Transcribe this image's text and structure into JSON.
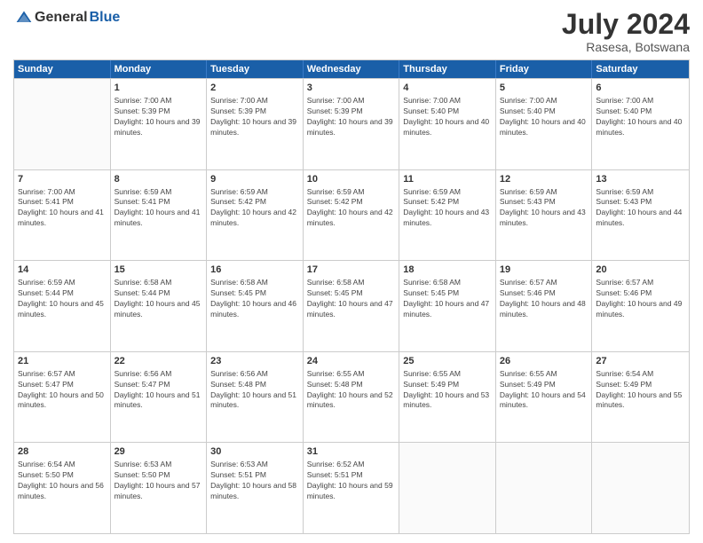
{
  "logo": {
    "general": "General",
    "blue": "Blue"
  },
  "header": {
    "month_year": "July 2024",
    "location": "Rasesa, Botswana"
  },
  "weekdays": [
    "Sunday",
    "Monday",
    "Tuesday",
    "Wednesday",
    "Thursday",
    "Friday",
    "Saturday"
  ],
  "weeks": [
    [
      {
        "day": "",
        "sunrise": "",
        "sunset": "",
        "daylight": ""
      },
      {
        "day": "1",
        "sunrise": "Sunrise: 7:00 AM",
        "sunset": "Sunset: 5:39 PM",
        "daylight": "Daylight: 10 hours and 39 minutes."
      },
      {
        "day": "2",
        "sunrise": "Sunrise: 7:00 AM",
        "sunset": "Sunset: 5:39 PM",
        "daylight": "Daylight: 10 hours and 39 minutes."
      },
      {
        "day": "3",
        "sunrise": "Sunrise: 7:00 AM",
        "sunset": "Sunset: 5:39 PM",
        "daylight": "Daylight: 10 hours and 39 minutes."
      },
      {
        "day": "4",
        "sunrise": "Sunrise: 7:00 AM",
        "sunset": "Sunset: 5:40 PM",
        "daylight": "Daylight: 10 hours and 40 minutes."
      },
      {
        "day": "5",
        "sunrise": "Sunrise: 7:00 AM",
        "sunset": "Sunset: 5:40 PM",
        "daylight": "Daylight: 10 hours and 40 minutes."
      },
      {
        "day": "6",
        "sunrise": "Sunrise: 7:00 AM",
        "sunset": "Sunset: 5:40 PM",
        "daylight": "Daylight: 10 hours and 40 minutes."
      }
    ],
    [
      {
        "day": "7",
        "sunrise": "Sunrise: 7:00 AM",
        "sunset": "Sunset: 5:41 PM",
        "daylight": "Daylight: 10 hours and 41 minutes."
      },
      {
        "day": "8",
        "sunrise": "Sunrise: 6:59 AM",
        "sunset": "Sunset: 5:41 PM",
        "daylight": "Daylight: 10 hours and 41 minutes."
      },
      {
        "day": "9",
        "sunrise": "Sunrise: 6:59 AM",
        "sunset": "Sunset: 5:42 PM",
        "daylight": "Daylight: 10 hours and 42 minutes."
      },
      {
        "day": "10",
        "sunrise": "Sunrise: 6:59 AM",
        "sunset": "Sunset: 5:42 PM",
        "daylight": "Daylight: 10 hours and 42 minutes."
      },
      {
        "day": "11",
        "sunrise": "Sunrise: 6:59 AM",
        "sunset": "Sunset: 5:42 PM",
        "daylight": "Daylight: 10 hours and 43 minutes."
      },
      {
        "day": "12",
        "sunrise": "Sunrise: 6:59 AM",
        "sunset": "Sunset: 5:43 PM",
        "daylight": "Daylight: 10 hours and 43 minutes."
      },
      {
        "day": "13",
        "sunrise": "Sunrise: 6:59 AM",
        "sunset": "Sunset: 5:43 PM",
        "daylight": "Daylight: 10 hours and 44 minutes."
      }
    ],
    [
      {
        "day": "14",
        "sunrise": "Sunrise: 6:59 AM",
        "sunset": "Sunset: 5:44 PM",
        "daylight": "Daylight: 10 hours and 45 minutes."
      },
      {
        "day": "15",
        "sunrise": "Sunrise: 6:58 AM",
        "sunset": "Sunset: 5:44 PM",
        "daylight": "Daylight: 10 hours and 45 minutes."
      },
      {
        "day": "16",
        "sunrise": "Sunrise: 6:58 AM",
        "sunset": "Sunset: 5:45 PM",
        "daylight": "Daylight: 10 hours and 46 minutes."
      },
      {
        "day": "17",
        "sunrise": "Sunrise: 6:58 AM",
        "sunset": "Sunset: 5:45 PM",
        "daylight": "Daylight: 10 hours and 47 minutes."
      },
      {
        "day": "18",
        "sunrise": "Sunrise: 6:58 AM",
        "sunset": "Sunset: 5:45 PM",
        "daylight": "Daylight: 10 hours and 47 minutes."
      },
      {
        "day": "19",
        "sunrise": "Sunrise: 6:57 AM",
        "sunset": "Sunset: 5:46 PM",
        "daylight": "Daylight: 10 hours and 48 minutes."
      },
      {
        "day": "20",
        "sunrise": "Sunrise: 6:57 AM",
        "sunset": "Sunset: 5:46 PM",
        "daylight": "Daylight: 10 hours and 49 minutes."
      }
    ],
    [
      {
        "day": "21",
        "sunrise": "Sunrise: 6:57 AM",
        "sunset": "Sunset: 5:47 PM",
        "daylight": "Daylight: 10 hours and 50 minutes."
      },
      {
        "day": "22",
        "sunrise": "Sunrise: 6:56 AM",
        "sunset": "Sunset: 5:47 PM",
        "daylight": "Daylight: 10 hours and 51 minutes."
      },
      {
        "day": "23",
        "sunrise": "Sunrise: 6:56 AM",
        "sunset": "Sunset: 5:48 PM",
        "daylight": "Daylight: 10 hours and 51 minutes."
      },
      {
        "day": "24",
        "sunrise": "Sunrise: 6:55 AM",
        "sunset": "Sunset: 5:48 PM",
        "daylight": "Daylight: 10 hours and 52 minutes."
      },
      {
        "day": "25",
        "sunrise": "Sunrise: 6:55 AM",
        "sunset": "Sunset: 5:49 PM",
        "daylight": "Daylight: 10 hours and 53 minutes."
      },
      {
        "day": "26",
        "sunrise": "Sunrise: 6:55 AM",
        "sunset": "Sunset: 5:49 PM",
        "daylight": "Daylight: 10 hours and 54 minutes."
      },
      {
        "day": "27",
        "sunrise": "Sunrise: 6:54 AM",
        "sunset": "Sunset: 5:49 PM",
        "daylight": "Daylight: 10 hours and 55 minutes."
      }
    ],
    [
      {
        "day": "28",
        "sunrise": "Sunrise: 6:54 AM",
        "sunset": "Sunset: 5:50 PM",
        "daylight": "Daylight: 10 hours and 56 minutes."
      },
      {
        "day": "29",
        "sunrise": "Sunrise: 6:53 AM",
        "sunset": "Sunset: 5:50 PM",
        "daylight": "Daylight: 10 hours and 57 minutes."
      },
      {
        "day": "30",
        "sunrise": "Sunrise: 6:53 AM",
        "sunset": "Sunset: 5:51 PM",
        "daylight": "Daylight: 10 hours and 58 minutes."
      },
      {
        "day": "31",
        "sunrise": "Sunrise: 6:52 AM",
        "sunset": "Sunset: 5:51 PM",
        "daylight": "Daylight: 10 hours and 59 minutes."
      },
      {
        "day": "",
        "sunrise": "",
        "sunset": "",
        "daylight": ""
      },
      {
        "day": "",
        "sunrise": "",
        "sunset": "",
        "daylight": ""
      },
      {
        "day": "",
        "sunrise": "",
        "sunset": "",
        "daylight": ""
      }
    ]
  ]
}
